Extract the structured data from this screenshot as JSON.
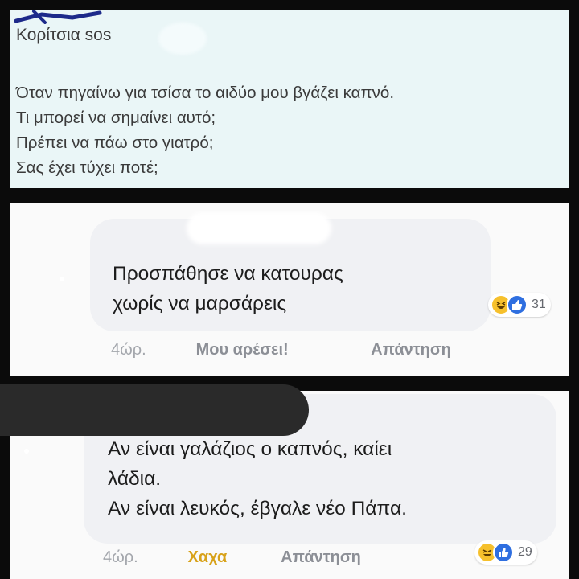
{
  "post": {
    "author": "Κορίτσια sos",
    "lines": [
      "Όταν πηγαίνω για τσίσα το αιδύο μου βγάζει καπνό.",
      "Τι μπορεί να σημαίνει αυτό;",
      "Πρέπει να πάω στο γιατρό;",
      "Σας έχει τύχει ποτέ;"
    ]
  },
  "comments": [
    {
      "lines": [
        "Προσπάθησε να κατουρας",
        "χωρίς να μαρσάρεις"
      ],
      "time": "4ώρ.",
      "like_label": "Μου αρέσει!",
      "reply_label": "Απάντηση",
      "reaction_icons": [
        "haha-icon",
        "like-icon"
      ],
      "reaction_count": "31"
    },
    {
      "lines": [
        "Αν είναι γαλάζιος ο καπνός, καίει",
        "λάδια.",
        "Αν είναι λευκός, έβγαλε νέο Πάπα."
      ],
      "time": "4ώρ.",
      "like_label": "Χαχα",
      "reply_label": "Απάντηση",
      "reaction_icons": [
        "haha-icon",
        "like-icon"
      ],
      "reaction_count": "29"
    }
  ],
  "colors": {
    "post_background": "#eaf6f7",
    "bubble_background": "#f0f1f4",
    "haha_accent": "#d8a21a",
    "like_blue": "#2f6fe0",
    "page_background": "#0b0b0b"
  }
}
